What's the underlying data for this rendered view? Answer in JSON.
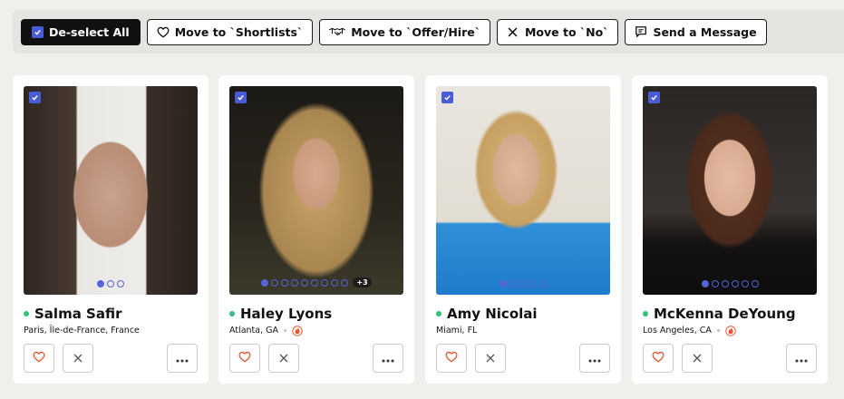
{
  "toolbar": {
    "deselect_label": "De-select All",
    "shortlist_label": "Move to `Shortlists`",
    "offer_label": "Move to `Offer/Hire`",
    "no_label": "Move to `No`",
    "message_label": "Send a Message"
  },
  "colors": {
    "accent": "#4a5bd6",
    "online": "#2ec27e",
    "like": "#e0542f"
  },
  "icons": {
    "like": "heart-icon",
    "reject": "x-icon",
    "more": "ellipsis-icon",
    "hot": "flame-icon",
    "selected": "checkbox-checked-icon"
  },
  "candidates": [
    {
      "name": "Salma Safir",
      "location": "Paris, Île-de-France, France",
      "photo_count": 3,
      "active_photo": 1,
      "extra_photos": "",
      "hot": false,
      "selected": true
    },
    {
      "name": "Haley Lyons",
      "location": "Atlanta, GA",
      "photo_count": 9,
      "active_photo": 1,
      "extra_photos": "+3",
      "hot": true,
      "selected": true
    },
    {
      "name": "Amy Nicolai",
      "location": "Miami, FL",
      "photo_count": 5,
      "active_photo": 1,
      "extra_photos": "",
      "hot": false,
      "selected": true
    },
    {
      "name": "McKenna DeYoung",
      "location": "Los Angeles, CA",
      "photo_count": 6,
      "active_photo": 1,
      "extra_photos": "",
      "hot": true,
      "selected": true
    }
  ]
}
